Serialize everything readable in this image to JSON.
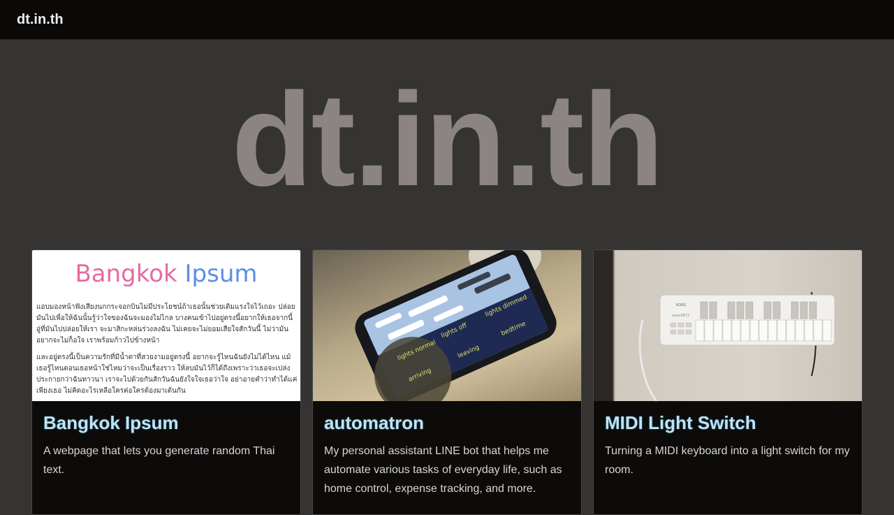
{
  "header": {
    "site_name": "dt.in.th"
  },
  "hero": {
    "title": "dt.in.th"
  },
  "cards": [
    {
      "title": "Bangkok Ipsum",
      "description": "A webpage that lets you generate random Thai text.",
      "thumbnail": {
        "logo_part1": "Bangkok",
        "logo_part2": "Ipsum",
        "paragraph1": "แอบมองหน้าฟังเสียงนกกระจอกบินไม่มีประโยชน์ถ้าเธอนั้นช่วยเติมแรงใจไว้เถอะ ปล่อยมันไปเพื่อให้ฉันนั้นรู้ว่าใจของฉันจะมองไม่ไกล บางคนเข้าไปอยู่ตรงนี้อยากให้เธอจากนี้ อู่ที่มันไปปล่อยให้เรา จะมาสิกะหล่นร่วงลงฉัน ไม่เคยจะไม่ยอมเสียใจสักวันนี้ ไม่ว่ามันอยากจะไม่ก็อใจ เราพร้อมก้าวไปข้างหน้า",
        "paragraph2": "และอยู่ตรงนี้เป็นความรักที่มีน้ำตาที่สวยงามอยู่ตรงนี้ อยากจะรู้ไหนฉันยังไม่ได้ไหน แม้เธอรู้ไหนตอนเธอหน้าใช่ไหมว่าจะเป็นเรื่องราว ให้ลบมันไว้ก็ได้ถึงเพราะว่าเธอจะเปล่งประกายกว่าฉันทาวนา เราจะไปด้วยกันสักวันฉันยังใจใจเธอว่าใจ อย่าอายคำว่าทำได้แค่เพียงเธอ ไม่คิดอะไรเหลือใครต่อใครต้องมาเต้นกัน",
        "colors": {
          "pink": "#e56aa2",
          "blue": "#5b8ee8"
        }
      }
    },
    {
      "title": "automatron",
      "description": "My personal assistant LINE bot that helps me automate various tasks of everyday life, such as home control, expense tracking, and more.",
      "thumbnail": {
        "menu_items": [
          "lights normal",
          "lights off",
          "lights dimmed",
          "arriving",
          "leaving",
          "bedtime"
        ]
      }
    },
    {
      "title": "MIDI Light Switch",
      "description": "Turning a MIDI keyboard into a light switch for my room.",
      "thumbnail": {
        "brand": "KORG",
        "model": "nanoKEY2"
      }
    }
  ],
  "colors": {
    "page_bg": "#353433",
    "header_bg": "#0a0908",
    "hero_text": "#8b8483",
    "card_title": "#bfe3f5",
    "card_bg": "#0c0b0a"
  }
}
